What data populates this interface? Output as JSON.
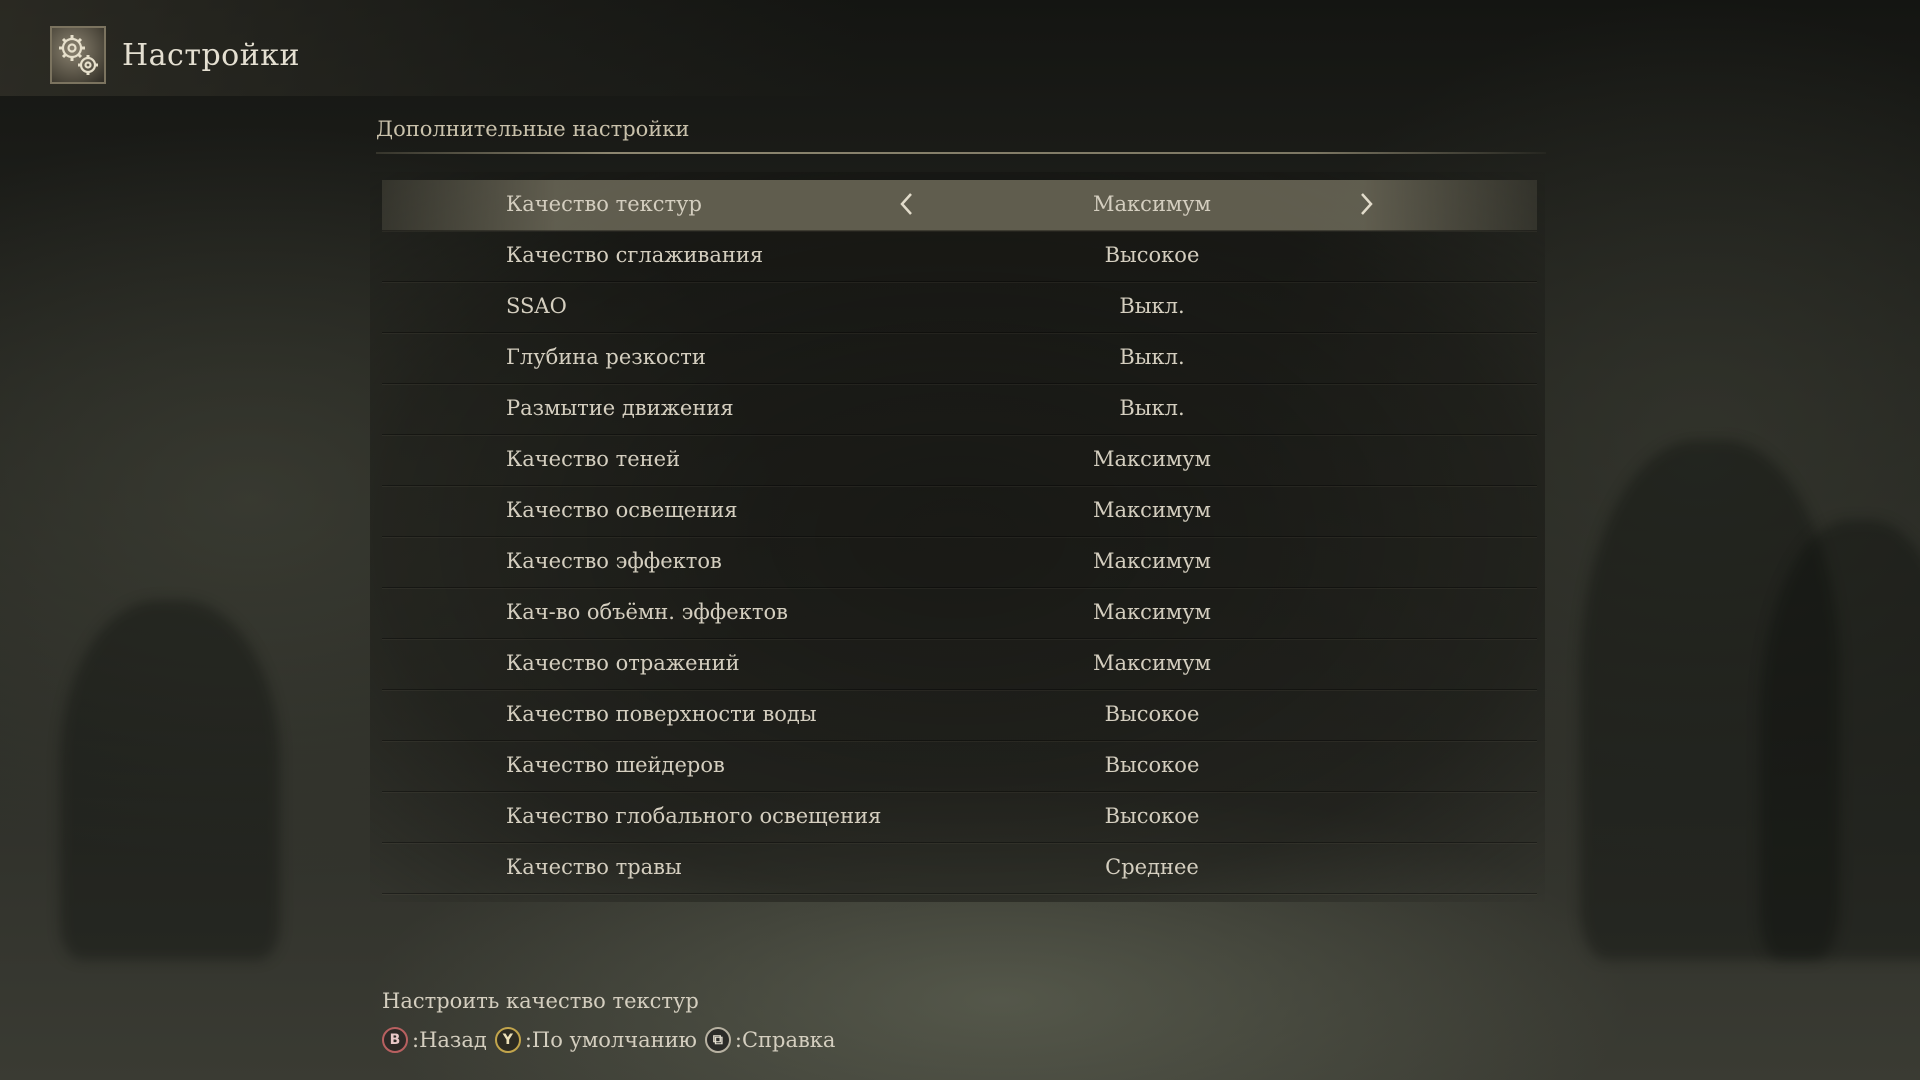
{
  "header": {
    "title": "Настройки",
    "icon": "gear-emblem-icon"
  },
  "section": {
    "title": "Дополнительные настройки"
  },
  "settings": [
    {
      "label": "Качество текстур",
      "value": "Максимум",
      "selected": true
    },
    {
      "label": "Качество сглаживания",
      "value": "Высокое"
    },
    {
      "label": "SSAO",
      "value": "Выкл."
    },
    {
      "label": "Глубина резкости",
      "value": "Выкл."
    },
    {
      "label": "Размытие движения",
      "value": "Выкл."
    },
    {
      "label": "Качество теней",
      "value": "Максимум"
    },
    {
      "label": "Качество освещения",
      "value": "Максимум"
    },
    {
      "label": "Качество эффектов",
      "value": "Максимум"
    },
    {
      "label": "Кач-во объёмн. эффектов",
      "value": "Максимум"
    },
    {
      "label": "Качество отражений",
      "value": "Максимум"
    },
    {
      "label": "Качество поверхности воды",
      "value": "Высокое"
    },
    {
      "label": "Качество шейдеров",
      "value": "Высокое"
    },
    {
      "label": "Качество глобального освещения",
      "value": "Высокое"
    },
    {
      "label": "Качество травы",
      "value": "Среднее"
    }
  ],
  "footer": {
    "help_text": "Настроить качество текстур",
    "hints": [
      {
        "glyph": "B",
        "icon": "b-button-icon",
        "label": ":Назад"
      },
      {
        "glyph": "Y",
        "icon": "y-button-icon",
        "label": ":По умолчанию"
      },
      {
        "glyph": "⧉",
        "icon": "view-button-icon",
        "label": ":Справка"
      }
    ]
  },
  "colors": {
    "text": "#d4cebf",
    "selected_row": "#78745f",
    "b_button": "#b86060",
    "y_button": "#c2a54c"
  }
}
